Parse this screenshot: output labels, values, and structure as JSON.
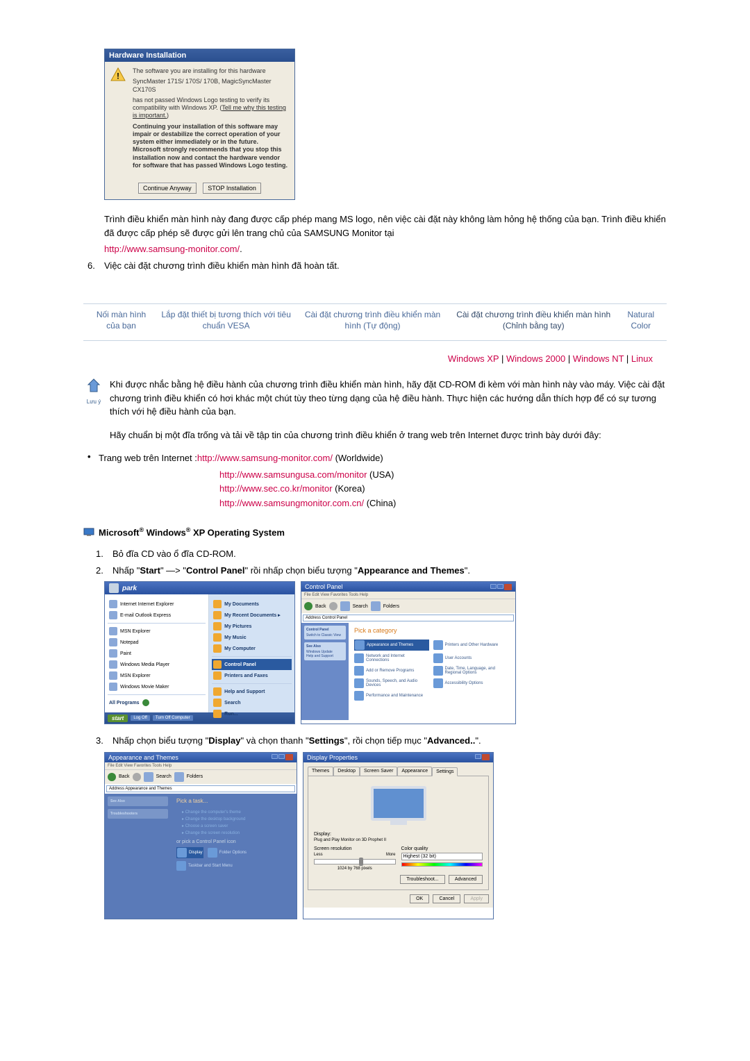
{
  "dialog": {
    "title": "Hardware Installation",
    "line1": "The software you are installing for this hardware",
    "line2": "SyncMaster 171S/ 170S/ 170B, MagicSyncMaster CX170S",
    "line3a": "has not passed Windows Logo testing to verify its compatibility with Windows XP. (",
    "line3link": "Tell me why this testing is important.",
    "line3b": ")",
    "line4": "Continuing your installation of this software may impair or destabilize the correct operation of your system either immediately or in the future. Microsoft strongly recommends that you stop this installation now and contact the hardware vendor for software that has passed Windows Logo testing.",
    "btn_continue": "Continue Anyway",
    "btn_stop": "STOP Installation"
  },
  "para": {
    "p1": "Trình điều khiển màn hình này đang được cấp phép mang MS logo, nên việc cài đặt này không làm hỏng hệ thống của bạn. Trình điều khiển đã được cấp phép sẽ được gửi lên trang chủ của SAMSUNG Monitor tại",
    "link1": "http://www.samsung-monitor.com/",
    "dot": ".",
    "item6num": "6.",
    "item6": "Việc cài đặt chương trình điều khiển màn hình đã hoàn tất."
  },
  "tabs": {
    "t1": "Nối màn hình của bạn",
    "t2": "Lắp đặt thiết bị tương thích với tiêu chuẩn VESA",
    "t3": "Cài đặt chương trình điều khiển màn hình (Tự động)",
    "t4": "Cài đặt chương trình điều khiển màn hình (Chỉnh bằng tay)",
    "t5": "Natural Color"
  },
  "oslinks": {
    "xp": "Windows XP",
    "w2k": "Windows 2000",
    "wnt": "Windows NT",
    "linux": "Linux",
    "sep": " | "
  },
  "note": {
    "label": "Lưu ý",
    "text": "Khi được nhắc bằng hệ điều hành của chương trình điều khiển màn hình, hãy đặt CD-ROM đi kèm với màn hình này vào máy. Việc cài đặt chương trình điều khiển có hơi khác một chút tùy theo từng dạng của hệ điều hành. Thực hiện các hướng dẫn thích hợp để có sự tương thích với hệ điều hành của bạn."
  },
  "prep": "Hãy chuẩn bị một đĩa trống và tải về tập tin của chương trình điều khiển ở trang web trên Internet được trình bày dưới đây:",
  "weblist": {
    "label": "Trang web trên Internet :",
    "l1": "http://www.samsung-monitor.com/",
    "l1s": " (Worldwide)",
    "l2": "http://www.samsungusa.com/monitor",
    "l2s": " (USA)",
    "l3": "http://www.sec.co.kr/monitor",
    "l3s": " (Korea)",
    "l4": "http://www.samsungmonitor.com.cn/",
    "l4s": " (China)"
  },
  "xpsection": {
    "title_a": "Microsoft",
    "title_b": " Windows",
    "title_c": " XP Operating System",
    "s1num": "1.",
    "s1": "Bỏ đĩa CD vào ổ đĩa CD-ROM.",
    "s2num": "2.",
    "s2a": "Nhấp \"",
    "s2b": "Start",
    "s2c": "\" —> \"",
    "s2d": "Control Panel",
    "s2e": "\" rồi nhấp chọn biểu tượng \"",
    "s2f": "Appearance and Themes",
    "s2g": "\".",
    "s3num": "3.",
    "s3a": "Nhấp chọn biểu tượng \"",
    "s3b": "Display",
    "s3c": "\" và chọn thanh \"",
    "s3d": "Settings",
    "s3e": "\", rồi chọn tiếp mục \"",
    "s3f": "Advanced..",
    "s3g": "\"."
  },
  "startmenu": {
    "user": "park",
    "left": [
      "Internet\nInternet Explorer",
      "E-mail\nOutlook Express",
      "MSN Explorer",
      "Notepad",
      "Paint",
      "Windows Media Player",
      "MSN Explorer",
      "Windows Movie Maker"
    ],
    "all": "All Programs",
    "right": [
      "My Documents",
      "My Recent Documents  ▸",
      "My Pictures",
      "My Music",
      "My Computer",
      "Control Panel",
      "Printers and Faxes",
      "Help and Support",
      "Search",
      "Run..."
    ],
    "start": "start",
    "logoff": "Log Off",
    "turnoff": "Turn Off Computer"
  },
  "cp": {
    "title": "Control Panel",
    "menu": "File  Edit  View  Favorites  Tools  Help",
    "back": "Back",
    "search": "Search",
    "folders": "Folders",
    "addr_lbl": "Address",
    "addr": "Control Panel",
    "side1": "Control Panel",
    "side1a": "Switch to Classic View",
    "side2": "See Also",
    "side2a": "Windows Update",
    "side2b": "Help and Support",
    "cat": "Pick a category",
    "items": [
      "Appearance and Themes",
      "Printers and Other Hardware",
      "Network and Internet Connections",
      "User Accounts",
      "Add or Remove Programs",
      "Date, Time, Language, and Regional Options",
      "Sounds, Speech, and Audio Devices",
      "Accessibility Options",
      "Performance and Maintenance"
    ]
  },
  "cpd": {
    "title": "Appearance and Themes",
    "side1": "See Also",
    "side2": "Troubleshooters",
    "pick": "Pick a task...",
    "tasks": [
      "Change the computer's theme",
      "Change the desktop background",
      "Choose a screen saver",
      "Change the screen resolution"
    ],
    "or": "or pick a Control Panel icon",
    "icons": [
      "Display",
      "Folder Options",
      "Taskbar and Start Menu"
    ]
  },
  "dp": {
    "title": "Display Properties",
    "tabs": [
      "Themes",
      "Desktop",
      "Screen Saver",
      "Appearance",
      "Settings"
    ],
    "disp": "Display:",
    "dispval": "Plug and Play Monitor on 3D Prophet II",
    "res": "Screen resolution",
    "less": "Less",
    "more": "More",
    "resval": "1024 by 768 pixels",
    "cq": "Color quality",
    "cqval": "Highest (32 bit)",
    "trouble": "Troubleshoot...",
    "adv": "Advanced",
    "ok": "OK",
    "cancel": "Cancel",
    "apply": "Apply"
  }
}
